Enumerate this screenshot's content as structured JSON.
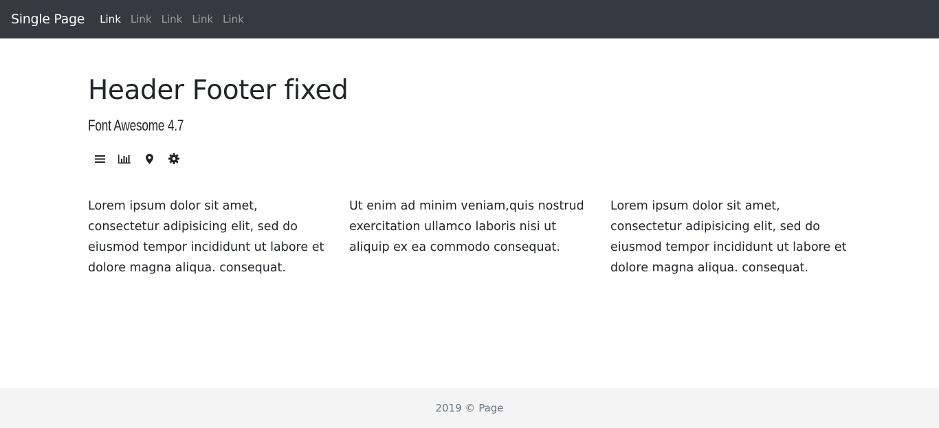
{
  "navbar": {
    "brand": "Single Page",
    "links": [
      {
        "label": "Link",
        "active": true
      },
      {
        "label": "Link",
        "active": false
      },
      {
        "label": "Link",
        "active": false
      },
      {
        "label": "Link",
        "active": false
      },
      {
        "label": "Link",
        "active": false
      }
    ]
  },
  "main": {
    "title": "Header Footer fixed",
    "subtitle": "Font Awesome 4.7",
    "icons": [
      "bars-icon",
      "bar-chart-icon",
      "map-marker-icon",
      "cog-icon"
    ],
    "columns": [
      {
        "text": "Lorem ipsum dolor sit amet, consectetur adipisicing elit, sed do eiusmod tempor incididunt ut labore et dolore magna aliqua. consequat."
      },
      {
        "text": "Ut enim ad minim veniam,quis nostrud exercitation ullamco laboris nisi ut aliquip ex ea commodo consequat."
      },
      {
        "text": "Lorem ipsum dolor sit amet, consectetur adipisicing elit, sed do eiusmod tempor incididunt ut labore et dolore magna aliqua. consequat."
      }
    ]
  },
  "footer": {
    "text": "2019 © Page"
  },
  "colors": {
    "navbar_bg": "#343a40",
    "footer_bg": "#f4f4f4",
    "text": "#212529",
    "muted": "#6c757d"
  }
}
